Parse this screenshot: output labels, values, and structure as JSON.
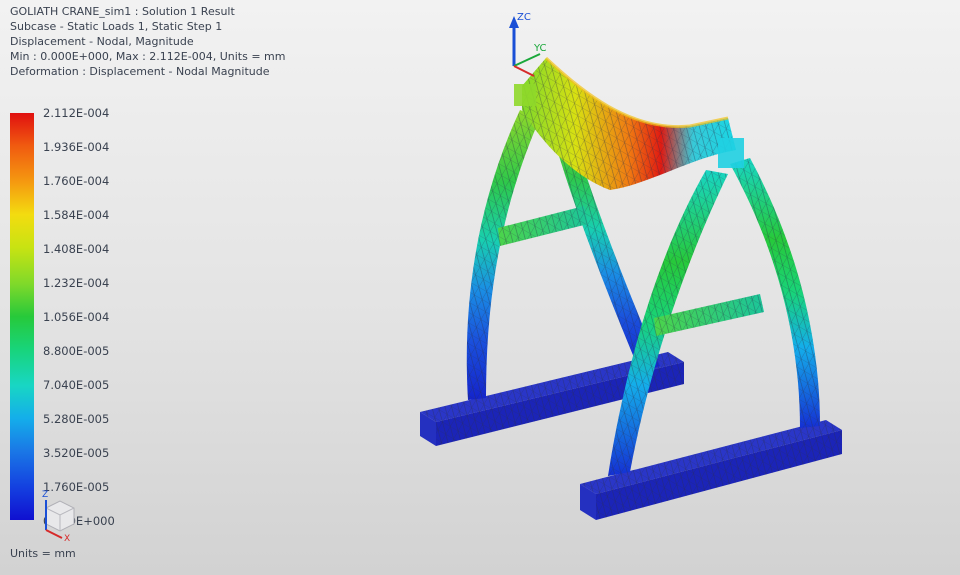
{
  "header": {
    "line1": "GOLIATH CRANE_sim1 : Solution 1 Result",
    "line2": "Subcase - Static Loads 1, Static Step 1",
    "line3": "Displacement - Nodal, Magnitude",
    "line4": "Min : 0.000E+000, Max : 2.112E-004, Units = mm",
    "line5": "Deformation : Displacement - Nodal Magnitude"
  },
  "legend": {
    "ticks": [
      "2.112E-004",
      "1.936E-004",
      "1.760E-004",
      "1.584E-004",
      "1.408E-004",
      "1.232E-004",
      "1.056E-004",
      "8.800E-005",
      "7.040E-005",
      "5.280E-005",
      "3.520E-005",
      "1.760E-005",
      "0.000E+000"
    ],
    "colors": [
      "#e01010",
      "#f05a10",
      "#f59a10",
      "#f3dc10",
      "#c8e312",
      "#7fd92a",
      "#27c93a",
      "#18d47a",
      "#18d6c4",
      "#14aeea",
      "#1a78e6",
      "#1440e0",
      "#1010d0"
    ],
    "units": "Units = mm"
  },
  "triad_top": {
    "z_label": "ZC",
    "y_label": "YC",
    "z_color": "#1a4fd6",
    "y_color": "#1aa83a",
    "x_color": "#d62a2a"
  },
  "triad_small": {
    "z_label": "Z",
    "x_label": "X"
  }
}
